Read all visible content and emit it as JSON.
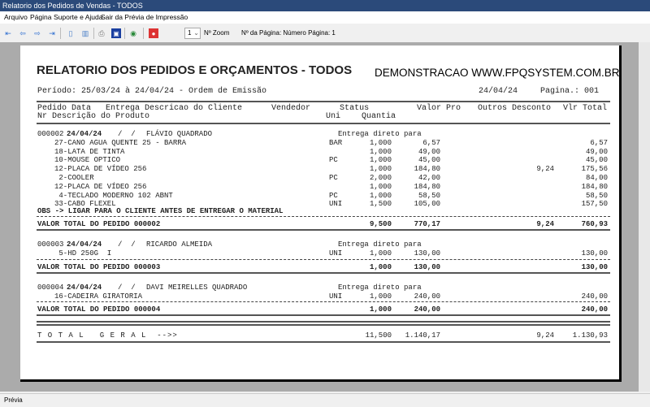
{
  "window": {
    "title": "Relatorio dos Pedidos de Vendas - TODOS"
  },
  "menu": [
    "Arquivo",
    "Página",
    "Suporte e Ajuda",
    "Sair da Prévia de Impressão"
  ],
  "toolbar": {
    "page_select": "1",
    "zoom_label": "Nº Zoom",
    "page_info": "Nº da Página: Número Página: 1"
  },
  "status": "Prévia",
  "report": {
    "title": "RELATORIO DOS PEDIDOS E ORÇAMENTOS - TODOS",
    "site": "DEMONSTRACAO WWW.FPQSYSTEM.COM.BR",
    "period": "Período: 25/03/24 à 24/04/24 - Ordem de Emissão",
    "date": "24/04/24",
    "page": "Pagina.: 001",
    "header1": "Pedido Data   Entrega Descricao do Cliente      Vendedor      Status",
    "header2": "Nr Descrição do Produto",
    "header_uni": "Uni",
    "header_qty": "Quantia",
    "header_valor": "Valor Pro",
    "header_outros": "Outros Desconto",
    "header_total": "Vlr Total",
    "orders": [
      {
        "number": "000002",
        "date": "24/04/24",
        "entrega": "/  /",
        "client": "FLÁVIO QUADRADO",
        "status": "Entrega direto para",
        "items": [
          {
            "desc": "27-CANO AGUA QUENTE 25 - BARRA",
            "uni": "BAR",
            "qty": "1,000",
            "valor": "6,57",
            "desc_val": "",
            "total": "6,57"
          },
          {
            "desc": "18-LATA DE TINTA",
            "uni": "",
            "qty": "1,000",
            "valor": "49,00",
            "desc_val": "",
            "total": "49,00"
          },
          {
            "desc": "10-MOUSE OPTICO",
            "uni": "PC",
            "qty": "1,000",
            "valor": "45,00",
            "desc_val": "",
            "total": "45,00"
          },
          {
            "desc": "12-PLACA DE VÍDEO 256",
            "uni": "",
            "qty": "1,000",
            "valor": "184,80",
            "desc_val": "9,24",
            "total": "175,56"
          },
          {
            "desc": " 2-COOLER",
            "uni": "PC",
            "qty": "2,000",
            "valor": "42,00",
            "desc_val": "",
            "total": "84,00"
          },
          {
            "desc": "12-PLACA DE VÍDEO 256",
            "uni": "",
            "qty": "1,000",
            "valor": "184,80",
            "desc_val": "",
            "total": "184,80"
          },
          {
            "desc": " 4-TECLADO MODERNO 102 ABNT",
            "uni": "PC",
            "qty": "1,000",
            "valor": "58,50",
            "desc_val": "",
            "total": "58,50"
          },
          {
            "desc": "33-CABO FLEXEL",
            "uni": "UNI",
            "qty": "1,500",
            "valor": "105,00",
            "desc_val": "",
            "total": "157,50"
          }
        ],
        "obs": "OBS -> LIGAR PARA O CLIENTE ANTES DE ENTREGAR O MATERIAL",
        "total_label": "VALOR TOTAL DO PEDIDO 000002",
        "total_qty": "9,500",
        "total_valor": "770,17",
        "total_desc": "9,24",
        "total_total": "760,93"
      },
      {
        "number": "000003",
        "date": "24/04/24",
        "entrega": "/  /",
        "client": "RICARDO ALMEIDA",
        "status": "Entrega direto para",
        "items": [
          {
            "desc": " 5-HD 250G  I",
            "uni": "UNI",
            "qty": "1,000",
            "valor": "130,00",
            "desc_val": "",
            "total": "130,00"
          }
        ],
        "obs": "",
        "total_label": "VALOR TOTAL DO PEDIDO 000003",
        "total_qty": "1,000",
        "total_valor": "130,00",
        "total_desc": "",
        "total_total": "130,00"
      },
      {
        "number": "000004",
        "date": "24/04/24",
        "entrega": "/  /",
        "client": "DAVI MEIRELLES QUADRADO",
        "status": "Entrega direto para",
        "items": [
          {
            "desc": "16-CADEIRA GIRATORIA",
            "uni": "UNI",
            "qty": "1,000",
            "valor": "240,00",
            "desc_val": "",
            "total": "240,00"
          }
        ],
        "obs": "",
        "total_label": "VALOR TOTAL DO PEDIDO 000004",
        "total_qty": "1,000",
        "total_valor": "240,00",
        "total_desc": "",
        "total_total": "240,00"
      }
    ],
    "grand": {
      "label": "T O T A L   G E R A L  -->>",
      "qty": "11,500",
      "valor": "1.140,17",
      "desc": "9,24",
      "total": "1.130,93"
    }
  }
}
